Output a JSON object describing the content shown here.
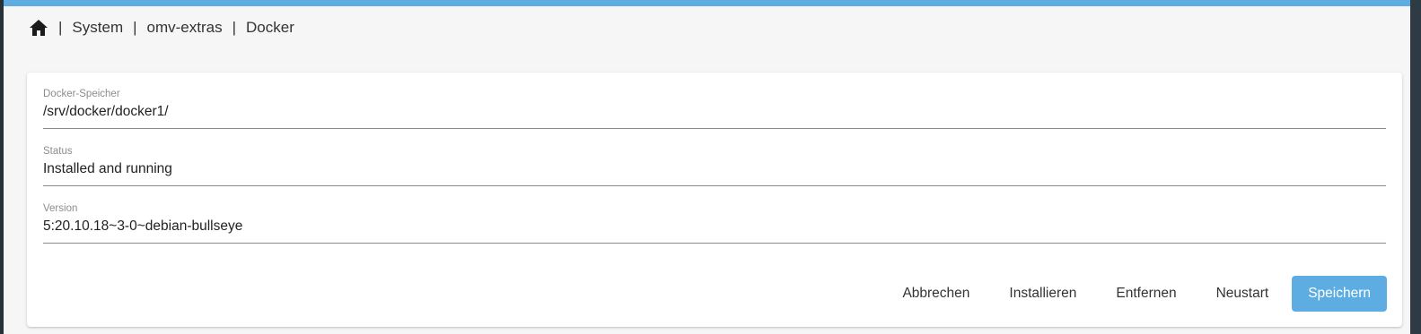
{
  "colors": {
    "accent": "#5dade2",
    "primary_button_text": "#ffffff"
  },
  "breadcrumb": {
    "home_icon": "home-icon",
    "items": [
      "System",
      "omv-extras",
      "Docker"
    ],
    "separator": "|"
  },
  "form": {
    "fields": [
      {
        "label": "Docker-Speicher",
        "value": "/srv/docker/docker1/"
      },
      {
        "label": "Status",
        "value": "Installed and running"
      },
      {
        "label": "Version",
        "value": "5:20.10.18~3-0~debian-bullseye"
      }
    ]
  },
  "actions": {
    "cancel_label": "Abbrechen",
    "install_label": "Installieren",
    "remove_label": "Entfernen",
    "restart_label": "Neustart",
    "save_label": "Speichern"
  }
}
